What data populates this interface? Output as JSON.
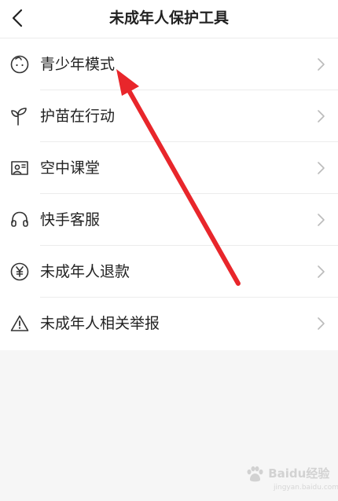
{
  "header": {
    "title": "未成年人保护工具",
    "back_icon": "chevron-left-icon"
  },
  "menu": {
    "items": [
      {
        "label": "青少年模式",
        "icon": "child-face-icon"
      },
      {
        "label": "护苗在行动",
        "icon": "sprout-icon"
      },
      {
        "label": "空中课堂",
        "icon": "classroom-screen-icon"
      },
      {
        "label": "快手客服",
        "icon": "headset-icon"
      },
      {
        "label": "未成年人退款",
        "icon": "yen-coin-icon"
      },
      {
        "label": "未成年人相关举报",
        "icon": "warning-triangle-icon"
      }
    ],
    "chevron_icon": "chevron-right-icon"
  },
  "annotation": {
    "arrow_color": "#e8262b",
    "points_to": "青少年模式"
  },
  "watermark": {
    "brand": "Baidu经验",
    "sub": "jingyan.baidu.com"
  },
  "colors": {
    "text": "#222222",
    "icon": "#333333",
    "chevron": "#bbbbbb",
    "background": "#f6f6f6"
  }
}
